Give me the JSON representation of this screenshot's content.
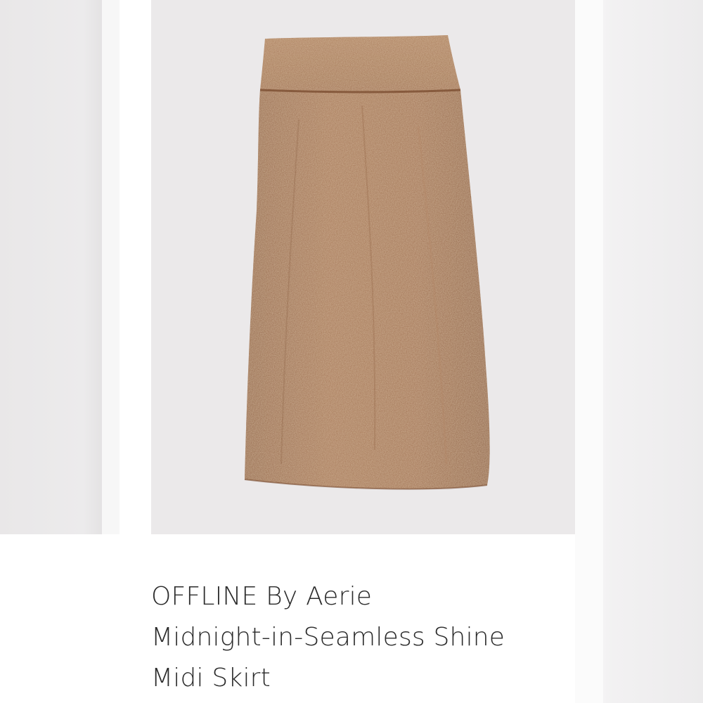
{
  "listing": {
    "title_lines": [
      "OFFLINE By Aerie",
      "Midnight-in-Seamless Shine",
      "Midi Skirt"
    ]
  },
  "image": {
    "subject": "skirt-photo",
    "fabric_color": "#a06e4c",
    "background_color": "#ebe9ea"
  }
}
